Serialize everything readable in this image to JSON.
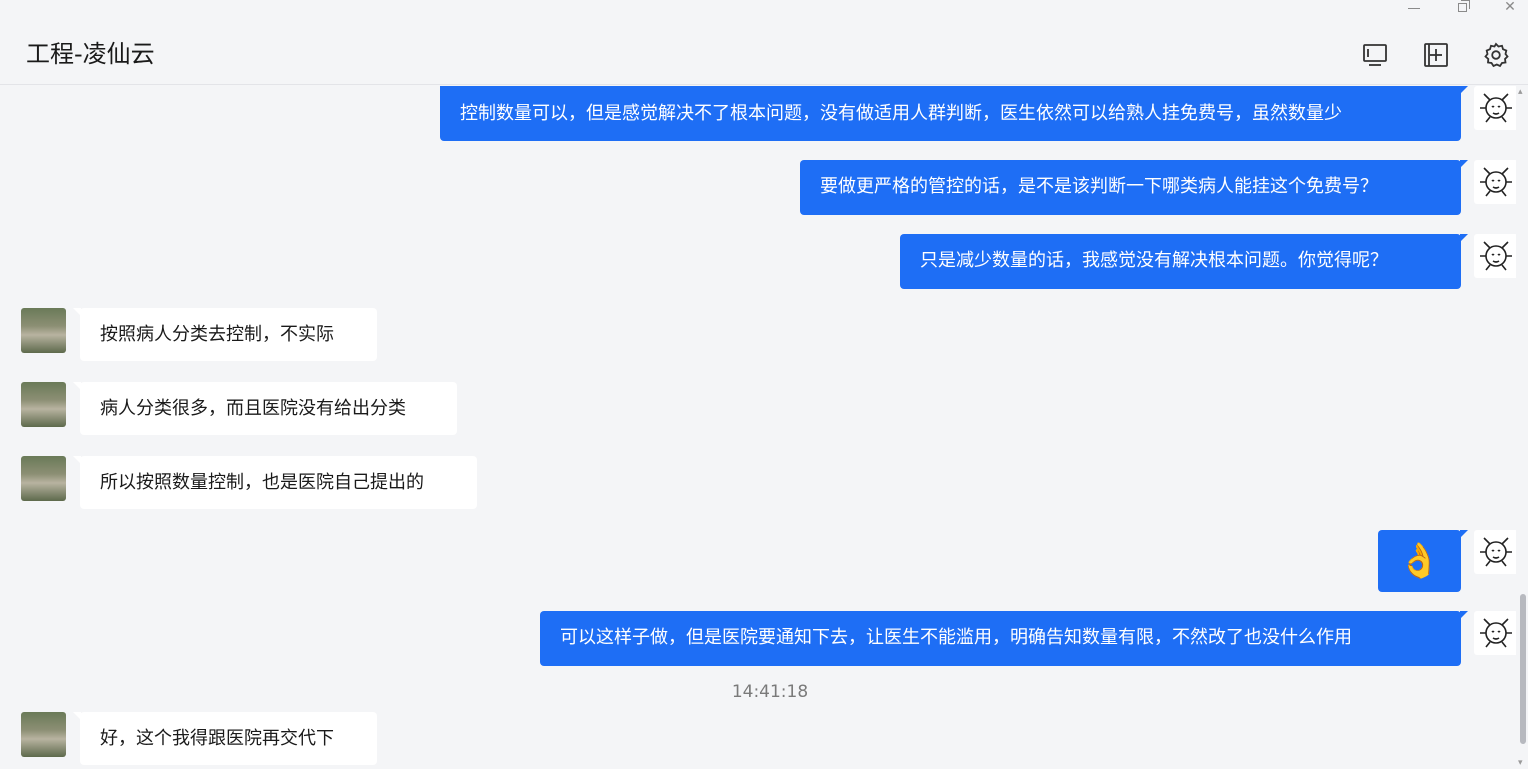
{
  "window": {
    "minimize_icon": "minimize-icon",
    "maximize_icon": "restore-icon",
    "close_label": "✕"
  },
  "header": {
    "title": "工程-凌仙云",
    "icons": [
      "screen-share-icon",
      "add-window-icon",
      "gear-icon"
    ]
  },
  "colors": {
    "self_bubble": "#1e6ef5",
    "other_bubble": "#ffffff",
    "background": "#f4f5f7"
  },
  "messages": [
    {
      "sender": "me",
      "text": "控制数量可以，但是感觉解决不了根本问题，没有做适用人群判断，医生依然可以给熟人挂免费号，虽然数量少"
    },
    {
      "sender": "me",
      "text": "要做更严格的管控的话，是不是该判断一下哪类病人能挂这个免费号？"
    },
    {
      "sender": "me",
      "text": "只是减少数量的话，我感觉没有解决根本问题。你觉得呢？"
    },
    {
      "sender": "other",
      "text": "按照病人分类去控制，不实际"
    },
    {
      "sender": "other",
      "text": "病人分类很多，而且医院没有给出分类"
    },
    {
      "sender": "other",
      "text": "所以按照数量控制，也是医院自己提出的"
    },
    {
      "sender": "me",
      "emoji": "👌",
      "emoji_name": "ok-hand-emoji"
    },
    {
      "sender": "me",
      "text": "可以这样子做，但是医院要通知下去，让医生不能滥用，明确告知数量有限，不然改了也没什么作用"
    },
    {
      "timestamp": "14:41:18"
    },
    {
      "sender": "other",
      "text": "好，这个我得跟医院再交代下"
    }
  ]
}
